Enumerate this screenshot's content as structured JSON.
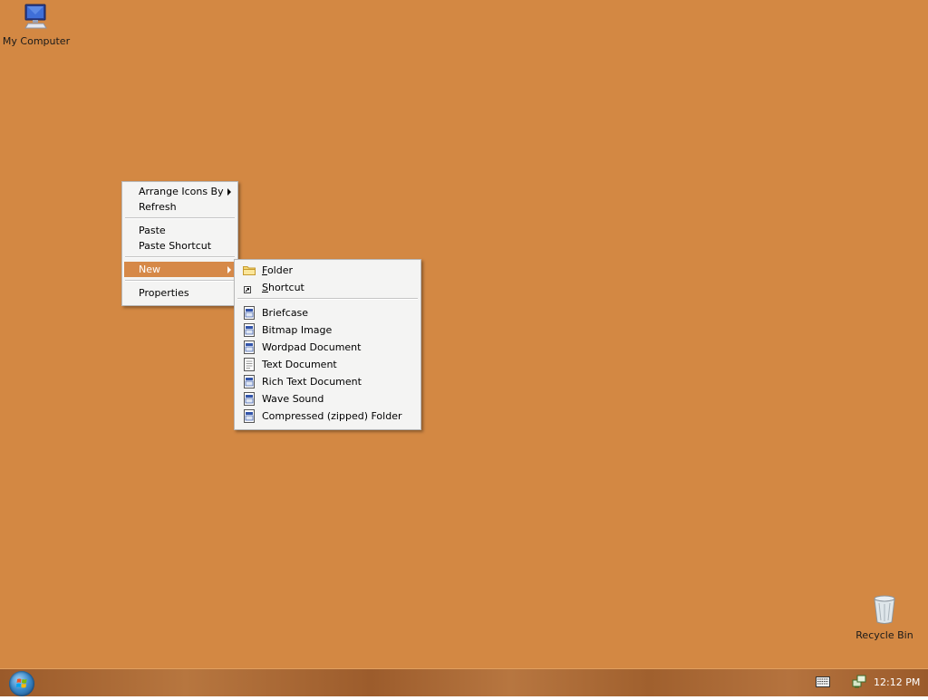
{
  "desktop": {
    "background_color": "#d38843",
    "icons": [
      {
        "label": "My Computer",
        "icon": "computer-icon"
      },
      {
        "label": "Recycle Bin",
        "icon": "recycle-bin-icon"
      }
    ]
  },
  "context_menu": {
    "items": [
      {
        "label": "Arrange Icons By",
        "submenu": true
      },
      {
        "label": "Refresh"
      },
      {
        "label": "Paste"
      },
      {
        "label": "Paste Shortcut"
      },
      {
        "label": "New",
        "submenu": true,
        "selected": true
      },
      {
        "label": "Properties"
      }
    ]
  },
  "new_submenu": {
    "items": [
      {
        "label_first": "F",
        "label_rest": "older",
        "icon": "folder-icon"
      },
      {
        "label_first": "S",
        "label_rest": "hortcut",
        "icon": "shortcut-icon"
      },
      {
        "label": "Briefcase",
        "icon": "document-icon"
      },
      {
        "label": "Bitmap Image",
        "icon": "document-icon"
      },
      {
        "label": "Wordpad Document",
        "icon": "document-icon"
      },
      {
        "label": "Text Document",
        "icon": "text-document-icon"
      },
      {
        "label": "Rich Text Document",
        "icon": "document-icon"
      },
      {
        "label": "Wave Sound",
        "icon": "document-icon"
      },
      {
        "label": "Compressed (zipped) Folder",
        "icon": "document-icon"
      }
    ]
  },
  "taskbar": {
    "start_icon": "windows-orb-icon",
    "tray_icons": [
      "keyboard-icon",
      "network-icon"
    ],
    "clock": "12:12 PM",
    "accent_color": "#d68948"
  }
}
